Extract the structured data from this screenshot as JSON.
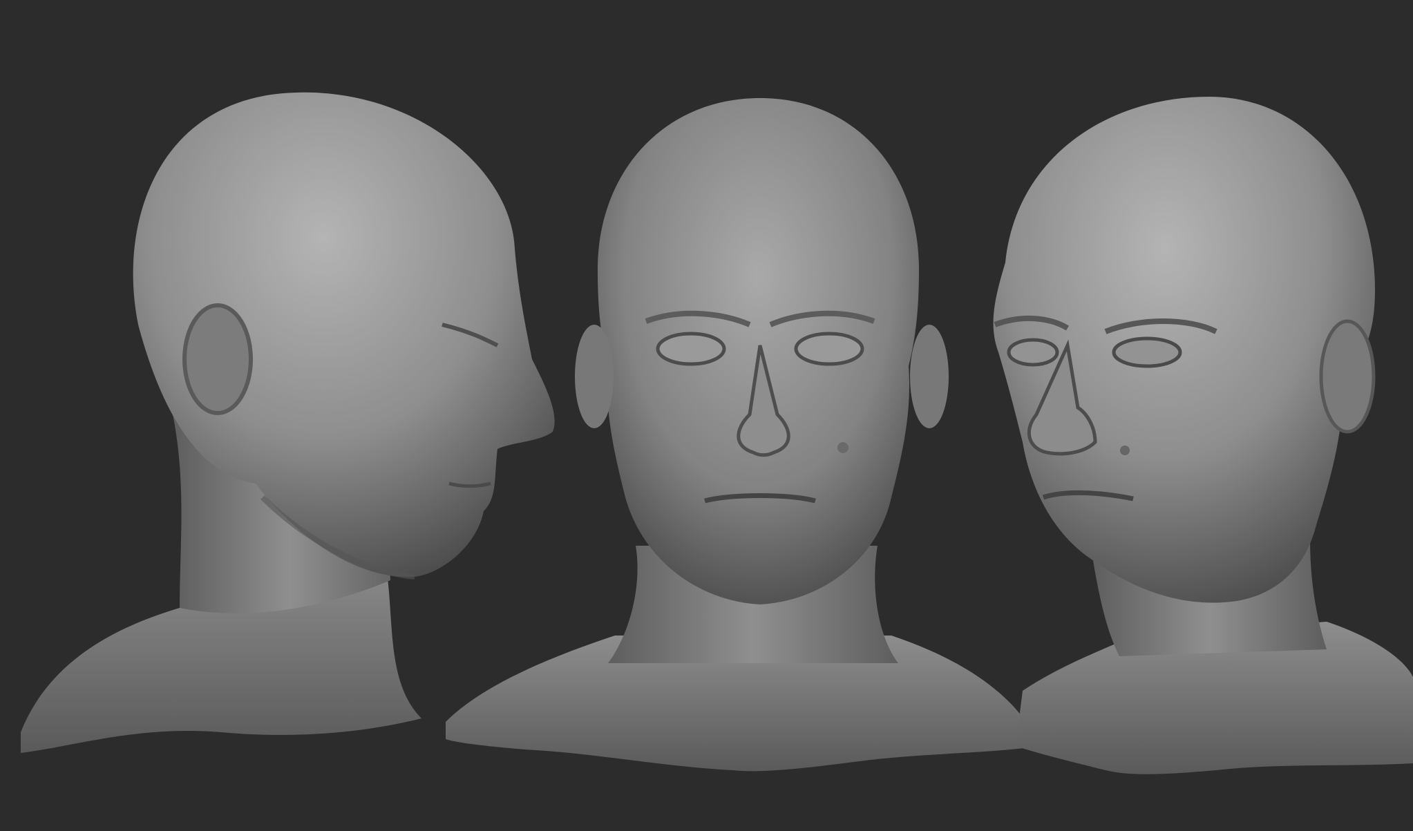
{
  "scene": {
    "background_color": "#2c2c2c",
    "clay_color": "#8a8a8a",
    "shadow_color": "#1d1d1d",
    "views": [
      {
        "name": "head-sculpt-right-profile",
        "orientation": "profile-right"
      },
      {
        "name": "head-sculpt-front",
        "orientation": "front"
      },
      {
        "name": "head-sculpt-three-quarter-left",
        "orientation": "three-quarter-left"
      }
    ]
  }
}
